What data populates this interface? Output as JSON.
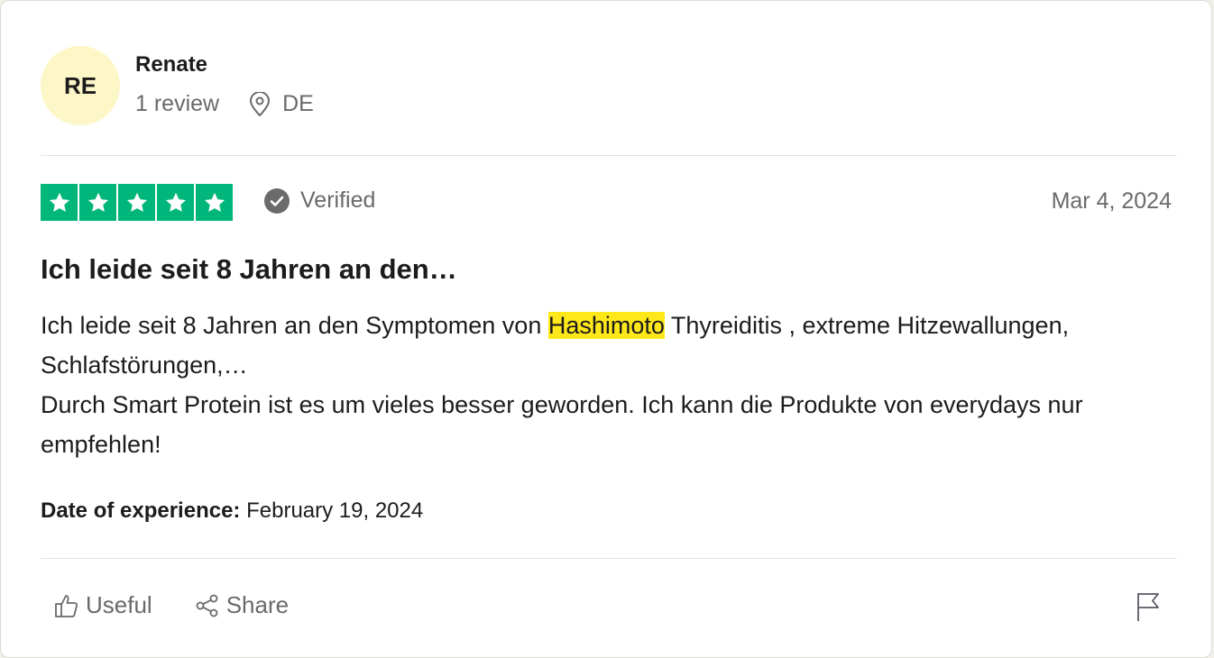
{
  "reviewer": {
    "initials": "RE",
    "name": "Renate",
    "review_count": "1 review",
    "country": "DE"
  },
  "review": {
    "rating": 5,
    "verified_label": "Verified",
    "posted_date": "Mar 4, 2024",
    "title": "Ich leide seit 8 Jahren an den…",
    "body_line1_before": "Ich leide seit 8 Jahren an den Symptomen von ",
    "body_highlight": "Hashimoto",
    "body_line1_after": " Thyreiditis , extreme Hitzewallungen, Schlafstörungen,…",
    "body_line2": "Durch Smart Protein ist es um vieles besser geworden. Ich kann die Produkte von everydays nur empfehlen!",
    "experience_label": "Date of experience:",
    "experience_date": "February 19, 2024"
  },
  "actions": {
    "useful_label": "Useful",
    "share_label": "Share"
  },
  "colors": {
    "star_green": "#00b67a",
    "highlight": "#ffe81a",
    "avatar_bg": "#fdf7c8",
    "muted_text": "#696a6a"
  }
}
